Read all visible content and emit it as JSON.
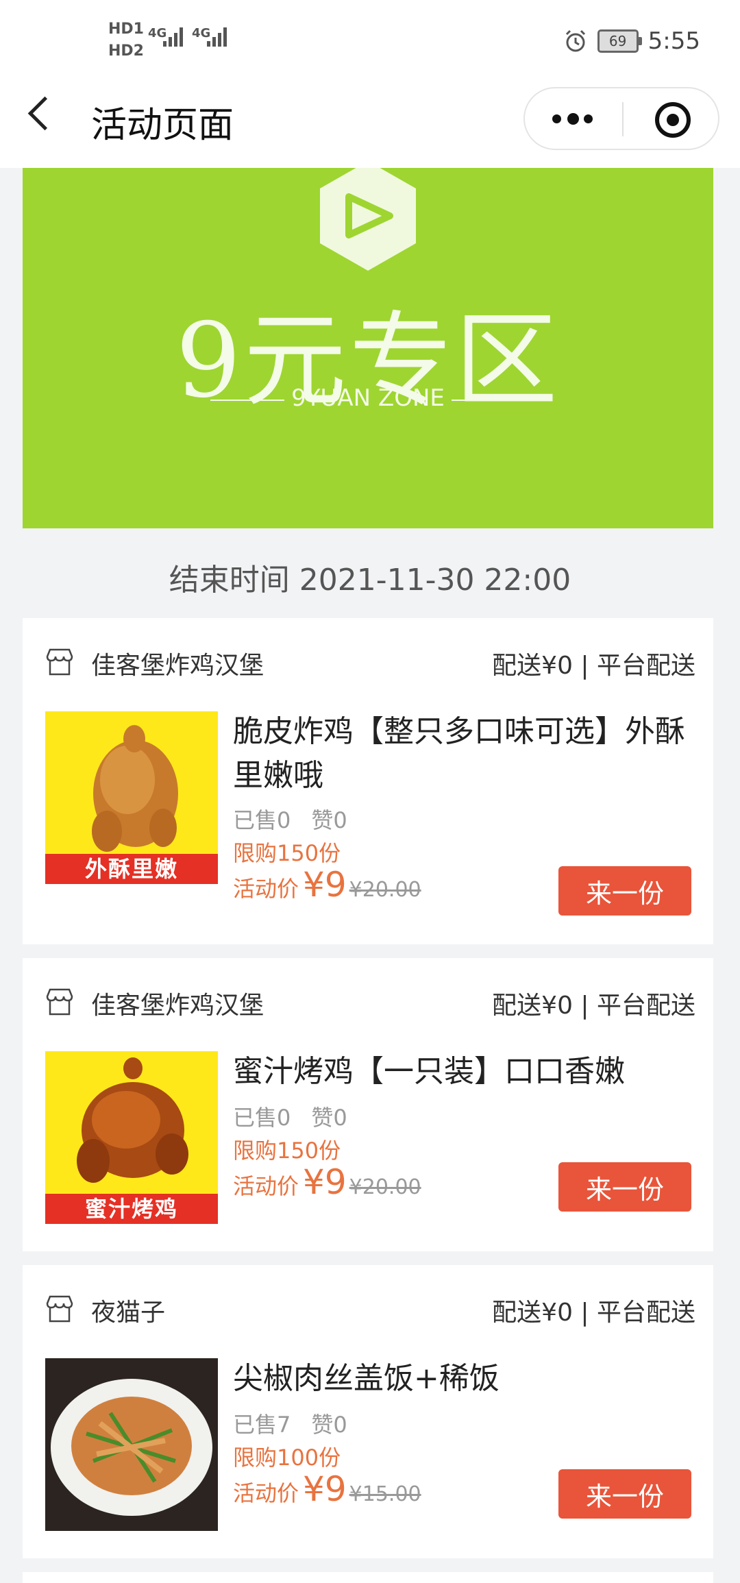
{
  "status_bar": {
    "sim1": "HD1",
    "sim1_net": "4G",
    "sim2": "HD2",
    "sim2_net": "4G",
    "battery": "69",
    "time": "5:55",
    "icons": [
      "alarm-icon",
      "battery-icon",
      "signal-icon"
    ]
  },
  "nav": {
    "title": "活动页面",
    "icons": [
      "back-icon",
      "more-icon",
      "target-icon"
    ]
  },
  "banner": {
    "title": "9元专区",
    "subtitle": "9YUAN ZONE",
    "background_color": "#9ed531"
  },
  "end_time": "结束时间 2021-11-30 22:00",
  "colors": {
    "accent": "#e8733f",
    "button": "#e8553a",
    "caption_red": "#e53025"
  },
  "items": [
    {
      "shop": "佳客堡炸鸡汉堡",
      "delivery": "配送¥0 | 平台配送",
      "thumb_caption": "外酥里嫩",
      "title": "脆皮炸鸡【整只多口味可选】外酥里嫩哦",
      "sold": "已售0",
      "likes": "赞0",
      "limit": "限购150份",
      "price_label": "活动价",
      "price": "¥9",
      "original_price": "¥20.00",
      "button": "来一份"
    },
    {
      "shop": "佳客堡炸鸡汉堡",
      "delivery": "配送¥0 | 平台配送",
      "thumb_caption": "蜜汁烤鸡",
      "title": "蜜汁烤鸡【一只装】口口香嫩",
      "sold": "已售0",
      "likes": "赞0",
      "limit": "限购150份",
      "price_label": "活动价",
      "price": "¥9",
      "original_price": "¥20.00",
      "button": "来一份"
    },
    {
      "shop": "夜猫子",
      "delivery": "配送¥0 | 平台配送",
      "title": "尖椒肉丝盖饭+稀饭",
      "sold": "已售7",
      "likes": "赞0",
      "limit": "限购100份",
      "price_label": "活动价",
      "price": "¥9",
      "original_price": "¥15.00",
      "button": "来一份"
    }
  ]
}
